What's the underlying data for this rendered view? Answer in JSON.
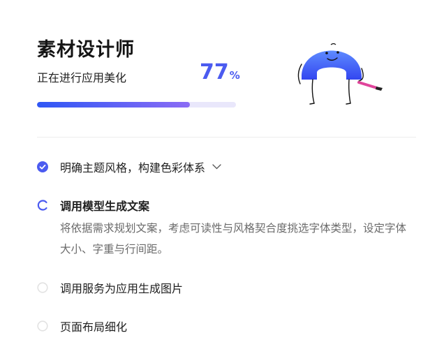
{
  "header": {
    "title": "素材设计师",
    "subtitle": "正在进行应用美化",
    "progress_value": "77",
    "progress_unit": "%",
    "progress_fraction": 0.77
  },
  "colors": {
    "accent": "#4b5bf0",
    "progress_start": "#2f57f5",
    "progress_end": "#8b6cf5",
    "track": "#e9e7fb"
  },
  "steps": [
    {
      "label": "明确主题风格，构建色彩体系",
      "status": "done",
      "icon": "check-circle-icon"
    },
    {
      "label": "调用模型生成文案",
      "status": "in-progress",
      "icon": "loading-spinner-icon",
      "description": "将依据需求规划文案，考虑可读性与风格契合度挑选字体类型，设定字体大小、字重与行间距。"
    },
    {
      "label": "调用服务为应用生成图片",
      "status": "pending",
      "icon": "empty-circle-icon"
    },
    {
      "label": "页面布局细化",
      "status": "pending",
      "icon": "empty-circle-icon"
    }
  ]
}
